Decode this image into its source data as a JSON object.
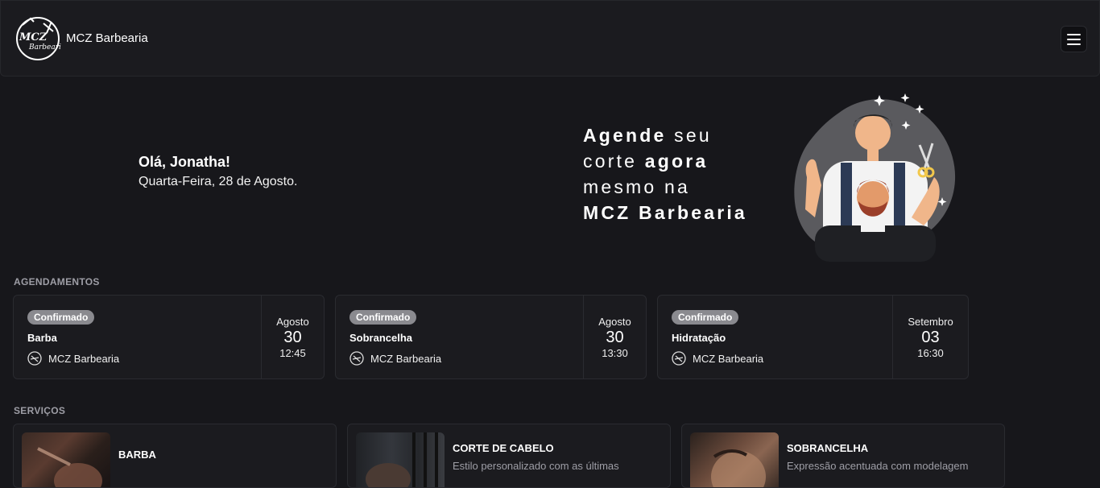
{
  "header": {
    "brand": "MCZ Barbearia",
    "logo_text_top": "MCZ",
    "logo_text_bottom": "Barbearia"
  },
  "welcome": {
    "greeting": "Olá, Jonatha!",
    "date": "Quarta-Feira, 28 de Agosto."
  },
  "hero": {
    "w1": "Agende",
    "w2": " seu",
    "w3": "corte ",
    "w4": "agora",
    "w5": "mesmo na",
    "w6": "MCZ Barbearia"
  },
  "appointments": {
    "title": "AGENDAMENTOS",
    "items": [
      {
        "status": "Confirmado",
        "service": "Barba",
        "shop": "MCZ Barbearia",
        "month": "Agosto",
        "day": "30",
        "time": "12:45"
      },
      {
        "status": "Confirmado",
        "service": "Sobrancelha",
        "shop": "MCZ Barbearia",
        "month": "Agosto",
        "day": "30",
        "time": "13:30"
      },
      {
        "status": "Confirmado",
        "service": "Hidratação",
        "shop": "MCZ Barbearia",
        "month": "Setembro",
        "day": "03",
        "time": "16:30"
      }
    ]
  },
  "services": {
    "title": "SERVIÇOS",
    "items": [
      {
        "name": "BARBA",
        "desc": ""
      },
      {
        "name": "CORTE DE CABELO",
        "desc": "Estilo personalizado com as últimas"
      },
      {
        "name": "SOBRANCELHA",
        "desc": "Expressão acentuada com modelagem"
      }
    ]
  },
  "icons": {
    "menu": "menu-icon",
    "logo": "barber-logo-icon",
    "shop": "shop-logo-icon"
  }
}
